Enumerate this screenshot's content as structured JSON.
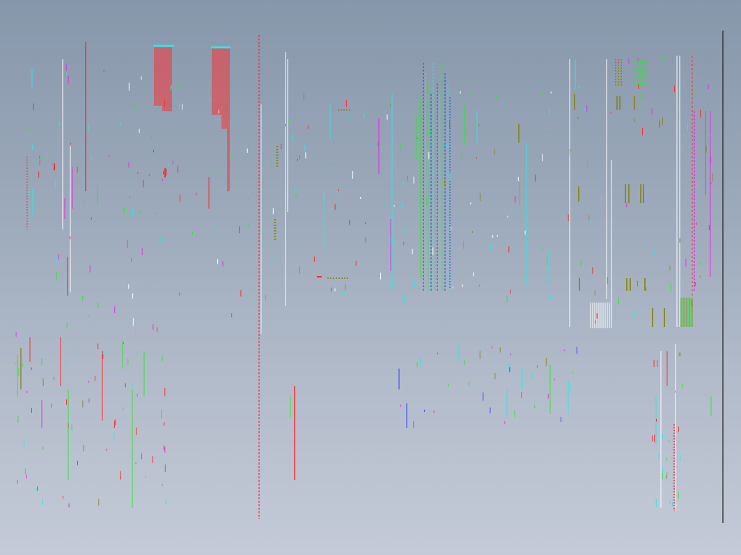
{
  "viewport": {
    "background_top": "#8797ab",
    "background_bottom": "#c4cad7"
  },
  "drawing": {
    "layer_colors": {
      "red": "#ff2a2a",
      "cyan": "#2ee6e6",
      "green": "#2ee62e",
      "white": "#ffffff",
      "magenta": "#e62ee6",
      "blue": "#2a3cff",
      "yellow": "#e6e62a",
      "black": "#1a1a1a",
      "olive": "#8a8a2a"
    }
  }
}
